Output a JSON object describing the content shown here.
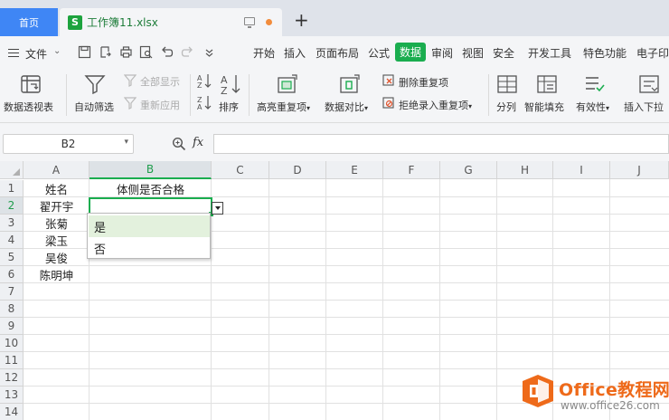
{
  "tabs": {
    "home": "首页",
    "file_icon": "S",
    "file_name": "工作簿11.xlsx",
    "add": "+"
  },
  "menubar": {
    "file_label": "文件",
    "items": [
      "开始",
      "插入",
      "页面布局",
      "公式",
      "数据",
      "审阅",
      "视图",
      "安全",
      "开发工具",
      "特色功能",
      "电子印"
    ],
    "active": "数据"
  },
  "ribbon": {
    "pivot": "数据透视表",
    "auto_filter": "自动筛选",
    "show_all": "全部显示",
    "reapply": "重新应用",
    "sort": "排序",
    "highlight_dup": "高亮重复项",
    "compare": "数据对比",
    "delete_dup": "删除重复项",
    "reject_dup": "拒绝录入重复项",
    "split": "分列",
    "smart_fill": "智能填充",
    "validity": "有效性",
    "insert_dropdown": "插入下拉"
  },
  "formula": {
    "cell_ref": "B2",
    "fx": "fx",
    "value": ""
  },
  "grid": {
    "columns": [
      "A",
      "B",
      "C",
      "D",
      "E",
      "F",
      "G",
      "H",
      "I",
      "J"
    ],
    "rows": [
      "1",
      "2",
      "3",
      "4",
      "5",
      "6",
      "7",
      "8",
      "9",
      "10",
      "11",
      "12",
      "13",
      "14"
    ],
    "selected_column": "B",
    "selected_row": "2",
    "cells": {
      "A1": "姓名",
      "B1": "体侧是否合格",
      "A2": "翟开宇",
      "A3": "张菊",
      "A4": "梁玉",
      "A5": "吴俊",
      "A6": "陈明坤"
    }
  },
  "dropdown": {
    "options": [
      "是",
      "否"
    ],
    "highlighted": "是"
  },
  "watermark": {
    "title": "Office教程网",
    "url": "www.office26.com"
  },
  "colors": {
    "accent_green": "#1aad4f",
    "home_tab_blue": "#3f86f5",
    "watermark_orange": "#ee6a1a"
  }
}
